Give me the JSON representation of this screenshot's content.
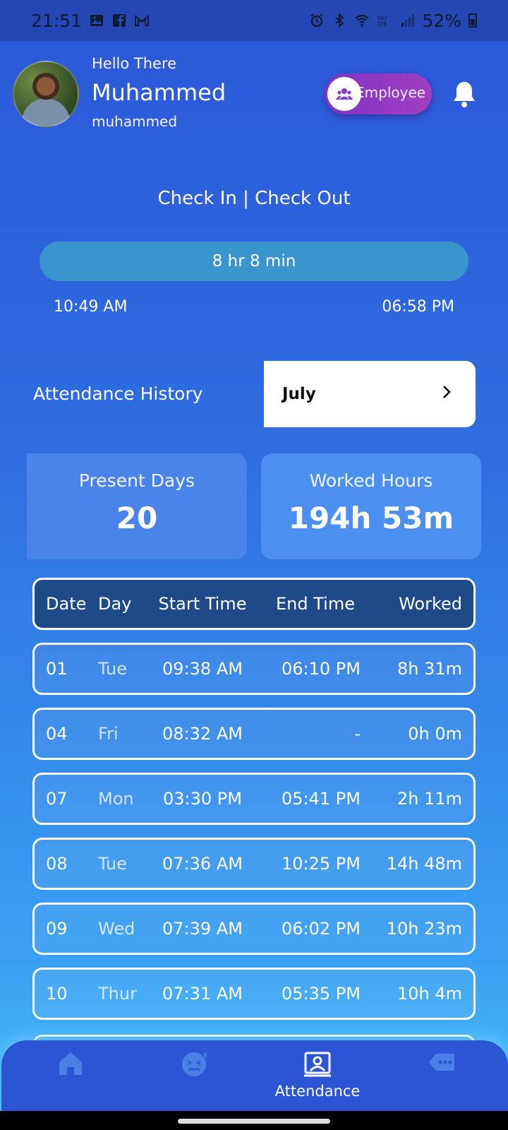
{
  "status_bar": {
    "time": "21:51",
    "battery": "52%"
  },
  "header": {
    "greeting": "Hello There",
    "name": "Muhammed",
    "username": "muhammed",
    "role": "Employee"
  },
  "checkin": {
    "title": "Check In | Check Out",
    "duration": "8 hr 8 min",
    "check_in": "10:49 AM",
    "check_out": "06:58 PM"
  },
  "history": {
    "title": "Attendance History",
    "month": "July"
  },
  "stats": {
    "present_label": "Present Days",
    "present_value": "20",
    "worked_label": "Worked Hours",
    "worked_value": "194h 53m"
  },
  "table": {
    "headers": {
      "date": "Date",
      "day": "Day",
      "start": "Start Time",
      "end": "End Time",
      "worked": "Worked"
    },
    "rows": [
      {
        "date": "01",
        "day": "Tue",
        "start": "09:38 AM",
        "end": "06:10 PM",
        "worked": "8h 31m"
      },
      {
        "date": "04",
        "day": "Fri",
        "start": "08:32 AM",
        "end": "-",
        "worked": "0h 0m"
      },
      {
        "date": "07",
        "day": "Mon",
        "start": "03:30 PM",
        "end": "05:41 PM",
        "worked": "2h 11m"
      },
      {
        "date": "08",
        "day": "Tue",
        "start": "07:36 AM",
        "end": "10:25 PM",
        "worked": "14h 48m"
      },
      {
        "date": "09",
        "day": "Wed",
        "start": "07:39 AM",
        "end": "06:02 PM",
        "worked": "10h 23m"
      },
      {
        "date": "10",
        "day": "Thur",
        "start": "07:31 AM",
        "end": "05:35 PM",
        "worked": "10h 4m"
      }
    ]
  },
  "nav": {
    "attendance_label": "Attendance",
    "items": [
      "home-icon",
      "sick-face-icon",
      "attendance-icon",
      "chat-icon"
    ]
  },
  "colors": {
    "accent_purple": "#8b38c4",
    "header_row": "#1f4a88",
    "nav_bg": "#2c55d3"
  }
}
